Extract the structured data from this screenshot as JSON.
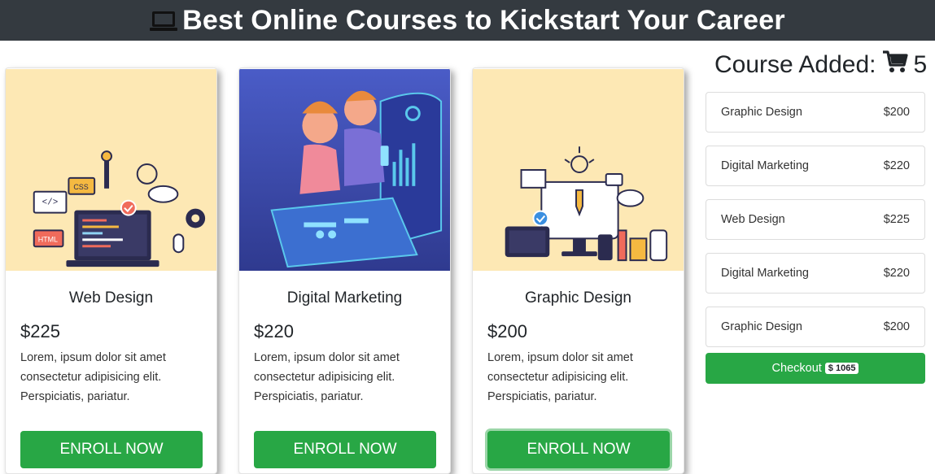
{
  "header": {
    "title": "Best Online Courses to Kickstart Your Career",
    "icon": "laptop-icon"
  },
  "courses": [
    {
      "title": "Web Design",
      "price": "$225",
      "description": "Lorem, ipsum dolor sit amet consectetur adipisicing elit. Perspiciatis, pariatur.",
      "button": "ENROLL NOW",
      "image": "web-design-illustration"
    },
    {
      "title": "Digital Marketing",
      "price": "$220",
      "description": "Lorem, ipsum dolor sit amet consectetur adipisicing elit. Perspiciatis, pariatur.",
      "button": "ENROLL NOW",
      "image": "digital-marketing-illustration"
    },
    {
      "title": "Graphic Design",
      "price": "$200",
      "description": "Lorem, ipsum dolor sit amet consectetur adipisicing elit. Perspiciatis, pariatur.",
      "button": "ENROLL NOW",
      "image": "graphic-design-illustration"
    }
  ],
  "cart": {
    "heading": "Course Added:",
    "icon": "shopping-cart-icon",
    "count": "5",
    "items": [
      {
        "name": "Graphic Design",
        "price": "$200"
      },
      {
        "name": "Digital Marketing",
        "price": "$220"
      },
      {
        "name": "Web Design",
        "price": "$225"
      },
      {
        "name": "Digital Marketing",
        "price": "$220"
      },
      {
        "name": "Graphic Design",
        "price": "$200"
      }
    ],
    "checkout_label": "Checkout",
    "total": "$ 1065"
  },
  "colors": {
    "header_bg": "#343a40",
    "success": "#28a745",
    "illustration_bg_warm": "#fde8b4",
    "illustration_bg_blue": "#3f4fb4"
  }
}
